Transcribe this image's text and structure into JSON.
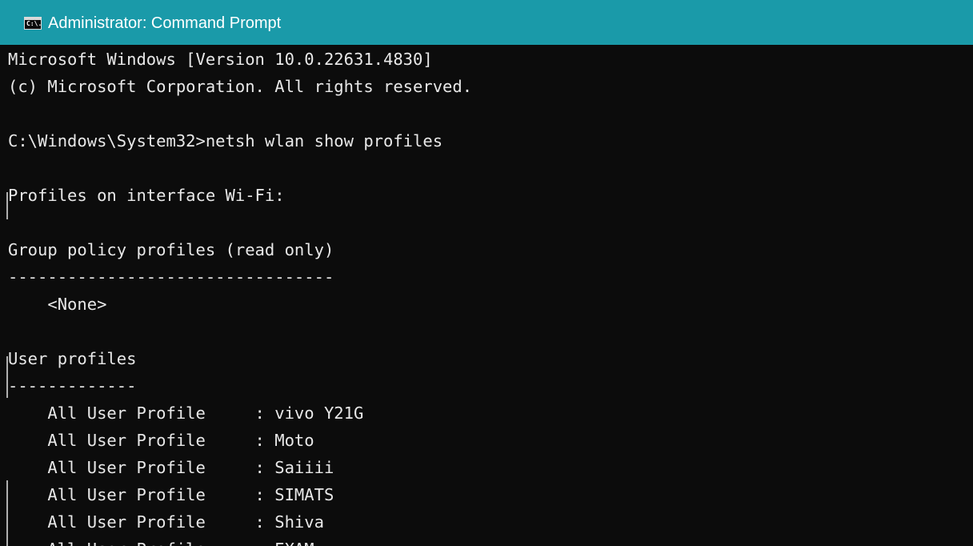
{
  "window": {
    "title": "Administrator: Command Prompt",
    "icon": "cmd-icon",
    "icon_text": "C:\\."
  },
  "console": {
    "lines": [
      "Microsoft Windows [Version 10.0.22631.4830]",
      "(c) Microsoft Corporation. All rights reserved.",
      "",
      "C:\\Windows\\System32>netsh wlan show profiles",
      "",
      "Profiles on interface Wi-Fi:",
      "",
      "Group policy profiles (read only)",
      "---------------------------------",
      "    <None>",
      "",
      "User profiles",
      "-------------",
      "    All User Profile     : vivo Y21G",
      "    All User Profile     : Moto",
      "    All User Profile     : Saiiii",
      "    All User Profile     : SIMATS",
      "    All User Profile     : Shiva",
      "    All User Profile     : EXAM"
    ]
  },
  "colors": {
    "titlebar": "#1a9aa9",
    "background": "#0c0c0c",
    "text": "#e8e8e8"
  }
}
